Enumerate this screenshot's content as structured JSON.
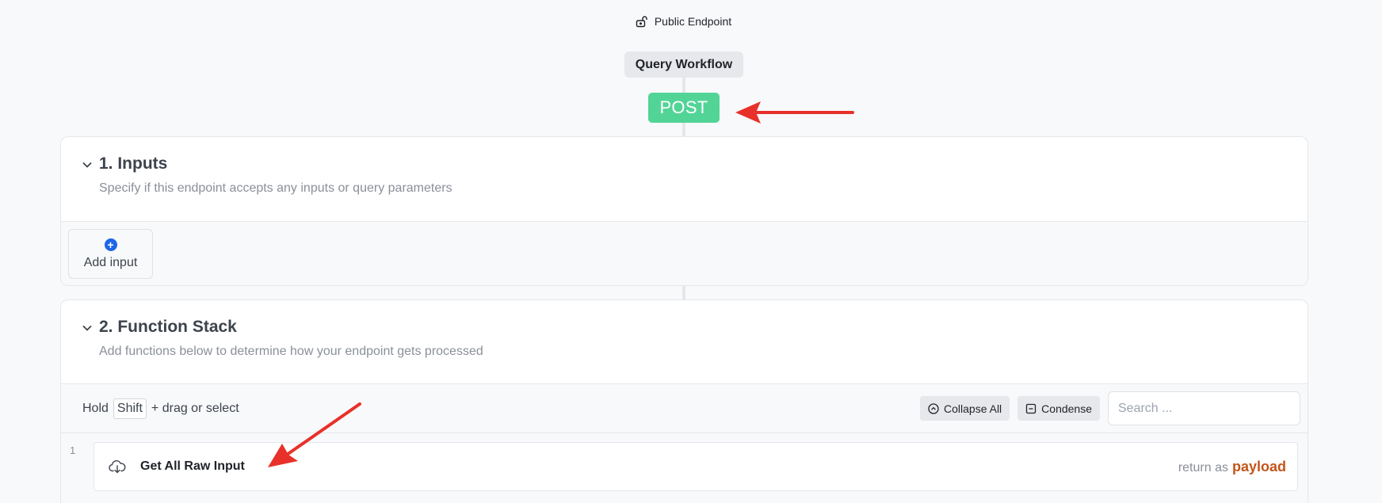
{
  "endpoint": {
    "access_label": "Public Endpoint",
    "access_icon": "unlock-icon",
    "workflow_label": "Query Workflow",
    "method": "POST",
    "method_color": "#53d497"
  },
  "inputs_section": {
    "title": "1. Inputs",
    "subtitle": "Specify if this endpoint accepts any inputs or query parameters",
    "add_label": "Add input",
    "add_icon": "plus-circle-icon"
  },
  "function_section": {
    "title": "2. Function Stack",
    "subtitle": "Add functions below to determine how your endpoint gets processed",
    "hint_prefix": "Hold",
    "hint_key": "Shift",
    "hint_suffix": "+ drag or select",
    "collapse_label": "Collapse All",
    "condense_label": "Condense",
    "search_placeholder": "Search ...",
    "steps": [
      {
        "number": "1",
        "icon": "cloud-download-icon",
        "title": "Get All Raw Input",
        "return_prefix": "return as",
        "return_var": "payload",
        "return_color": "#c2561a"
      }
    ]
  },
  "annotation_color": "#e8312a"
}
